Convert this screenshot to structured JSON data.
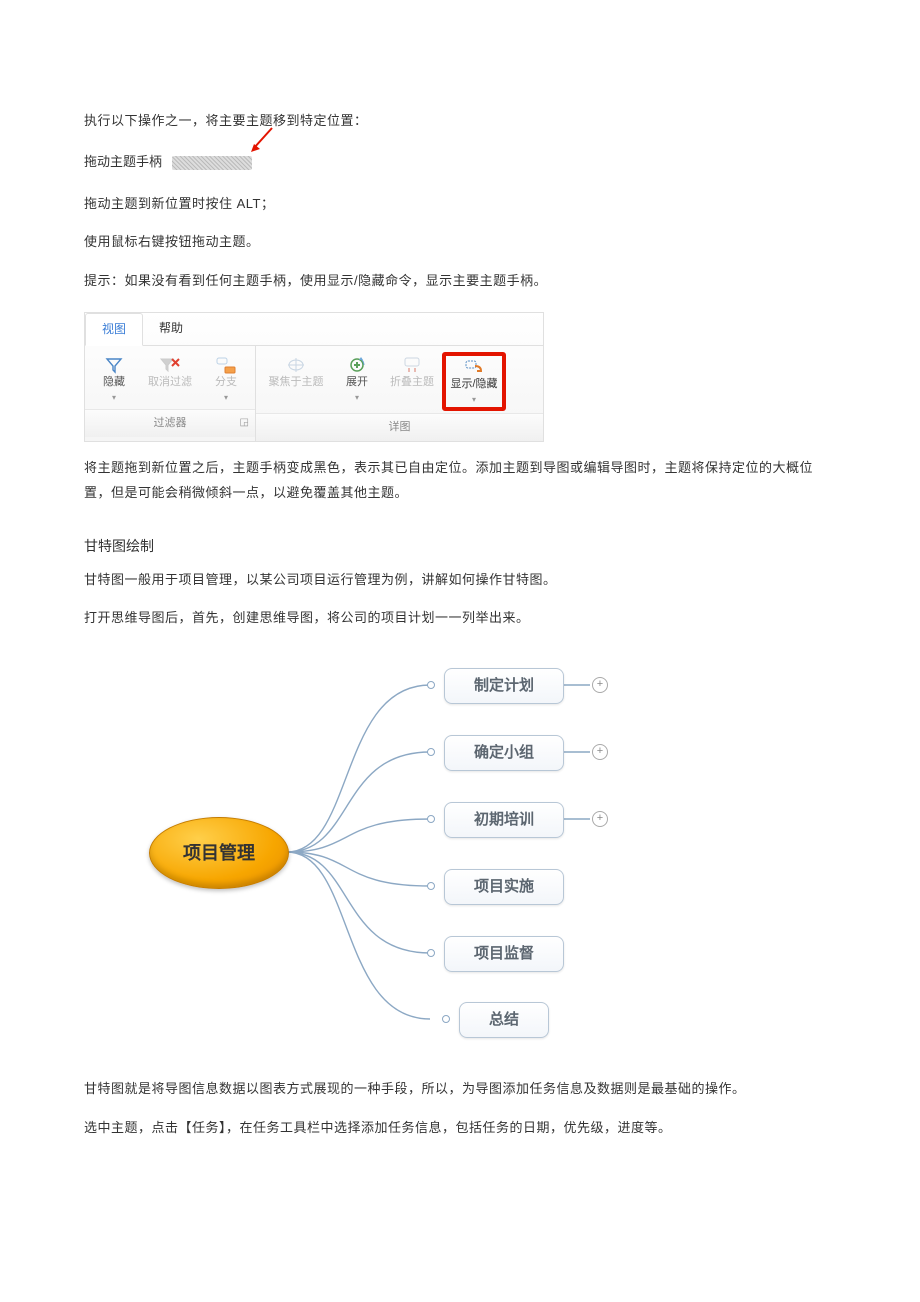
{
  "text": {
    "p1": "执行以下操作之一，将主要主题移到特定位置：",
    "p2_label": "拖动主题手柄",
    "p3": "拖动主题到新位置时按住 ALT；",
    "p4": "使用鼠标右键按钮拖动主题。",
    "p5": "提示：如果没有看到任何主题手柄，使用显示/隐藏命令，显示主要主题手柄。",
    "p6": "将主题拖到新位置之后，主题手柄变成黑色，表示其已自由定位。添加主题到导图或编辑导图时，主题将保持定位的大概位置，但是可能会稍微倾斜一点，以避免覆盖其他主题。",
    "heading_gantt": "甘特图绘制",
    "p7": "甘特图一般用于项目管理，以某公司项目运行管理为例，讲解如何操作甘特图。",
    "p8": "打开思维导图后，首先，创建思维导图，将公司的项目计划一一列举出来。",
    "p9": "甘特图就是将导图信息数据以图表方式展现的一种手段，所以，为导图添加任务信息及数据则是最基础的操作。",
    "p10": "选中主题，点击【任务】，在任务工具栏中选择添加任务信息，包括任务的日期，优先级，进度等。"
  },
  "ribbon": {
    "tabs": {
      "view": "视图",
      "help": "帮助"
    },
    "group_filter": "过滤器",
    "group_detail": "详图",
    "btn_hide": "隐藏",
    "btn_cancel_filter": "取消过滤",
    "btn_branch": "分支",
    "btn_focus": "聚焦于主题",
    "btn_expand": "展开",
    "btn_collapse": "折叠主题",
    "btn_show_hide": "显示/隐藏"
  },
  "mindmap": {
    "central": "项目管理",
    "nodes": [
      {
        "label": "制定计划",
        "expandable": true
      },
      {
        "label": "确定小组",
        "expandable": true
      },
      {
        "label": "初期培训",
        "expandable": true
      },
      {
        "label": "项目实施",
        "expandable": false
      },
      {
        "label": "项目监督",
        "expandable": false
      },
      {
        "label": "总结",
        "expandable": false
      }
    ]
  }
}
